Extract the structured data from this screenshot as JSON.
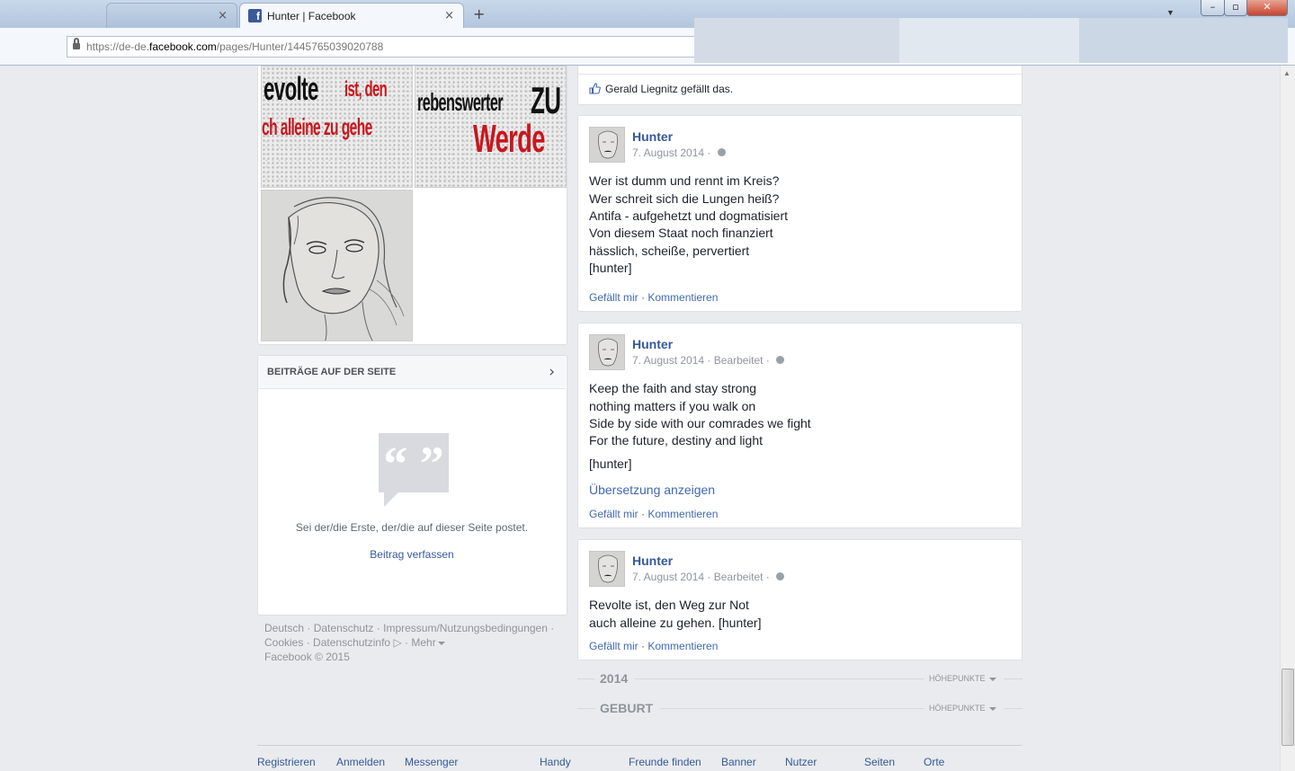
{
  "browser": {
    "tab_title": "Hunter | Facebook",
    "url_prefix": "https://de-de.",
    "url_host": "facebook.com",
    "url_path": "/pages/Hunter/1445765039020788",
    "tab_close": "×",
    "new_tab": "+",
    "win_min": "–",
    "win_max": "▫",
    "win_close": "✕"
  },
  "photos": {
    "poster1": {
      "line1_black": "evolte",
      "line1_red": "ist, den",
      "line2_red": "ch alleine zu gehe"
    },
    "poster2": {
      "line1_black": "rebenswerter",
      "line1_big": "ZU",
      "line2_red": "Werde"
    }
  },
  "likes": {
    "text": "Gerald Liegnitz gefällt das."
  },
  "posts_section": {
    "title": "BEITRÄGE AUF DER SEITE",
    "chevron": "›",
    "empty_text": "Sei der/die Erste, der/die auf dieser Seite postet.",
    "create_link": "Beitrag verfassen"
  },
  "footer": {
    "line1": [
      "Deutsch",
      "Datenschutz",
      "Impressum/Nutzungsbedingungen"
    ],
    "line2": [
      "Cookies",
      "Datenschutzinfo",
      "Mehr"
    ],
    "copyright": "Facebook © 2015",
    "sep": "·"
  },
  "posts": [
    {
      "author": "Hunter",
      "date": "7. August 2014",
      "edited": "",
      "lines": [
        "Wer ist dumm und rennt im Kreis?",
        "Wer schreit sich die Lungen heiß?",
        "Antifa - aufgehetzt und dogmatisiert",
        "Von diesem Staat noch finanziert",
        "hässlich, scheiße, pervertiert",
        "[hunter]"
      ],
      "like": "Gefällt mir",
      "comment": "Kommentieren"
    },
    {
      "author": "Hunter",
      "date": "7. August 2014",
      "edited": "Bearbeitet",
      "lines": [
        "Keep the faith and stay strong",
        "nothing matters if you walk on",
        "Side by side with our comrades we fight",
        "For the future, destiny and light",
        "[hunter]"
      ],
      "translate": "Übersetzung anzeigen",
      "like": "Gefällt mir",
      "comment": "Kommentieren"
    },
    {
      "author": "Hunter",
      "date": "7. August 2014",
      "edited": "Bearbeitet",
      "lines": [
        "Revolte ist, den Weg zur Not",
        "auch alleine zu gehen. [hunter]"
      ],
      "like": "Gefällt mir",
      "comment": "Kommentieren"
    }
  ],
  "timeline": [
    {
      "label": "2014",
      "highlights": "HÖHEPUNKTE"
    },
    {
      "label": "GEBURT",
      "highlights": "HÖHEPUNKTE"
    }
  ],
  "bottom_nav": [
    "Registrieren",
    "Anmelden",
    "Messenger",
    "Handy",
    "Freunde finden",
    "Banner",
    "Nutzer",
    "Seiten",
    "Orte"
  ],
  "colors": {
    "fb_blue": "#3b5998",
    "link": "#365899",
    "page_bg": "#e9ebee",
    "poster_red": "#c8161d"
  }
}
